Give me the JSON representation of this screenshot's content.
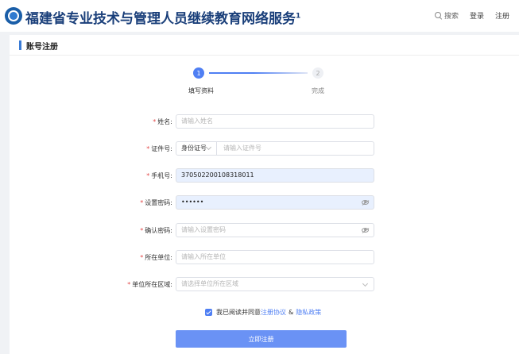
{
  "header": {
    "title": "福建省专业技术与管理人员继续教育网络服务",
    "title_sup": "1",
    "search_label": "搜索",
    "login_label": "登录",
    "register_label": "注册"
  },
  "card": {
    "title": "账号注册"
  },
  "steps": [
    {
      "number": "1",
      "label": "填写资料",
      "active": true
    },
    {
      "number": "2",
      "label": "完成",
      "active": false
    }
  ],
  "form": {
    "name": {
      "label": "姓名:",
      "placeholder": "请输入姓名"
    },
    "id": {
      "label": "证件号:",
      "type_value": "身份证号",
      "placeholder": "请输入证件号"
    },
    "phone": {
      "label": "手机号:",
      "value": "370502200108318011"
    },
    "password": {
      "label": "设置密码:",
      "value": "••••••"
    },
    "confirm": {
      "label": "确认密码:",
      "placeholder": "请输入设置密码"
    },
    "unit": {
      "label": "所在单位:",
      "placeholder": "请输入所在单位"
    },
    "region": {
      "label": "单位所在区域:",
      "placeholder": "请选择单位所在区域"
    },
    "required_mark": "*"
  },
  "agreement": {
    "prefix": "我已阅读并同意",
    "terms_link": "注册协议",
    "amp": "&",
    "privacy_link": "隐私政策",
    "checked": true
  },
  "submit_label": "立即注册",
  "colors": {
    "accent": "#4f7ff3",
    "title": "#1a3f7a",
    "required": "#e34b4b"
  }
}
